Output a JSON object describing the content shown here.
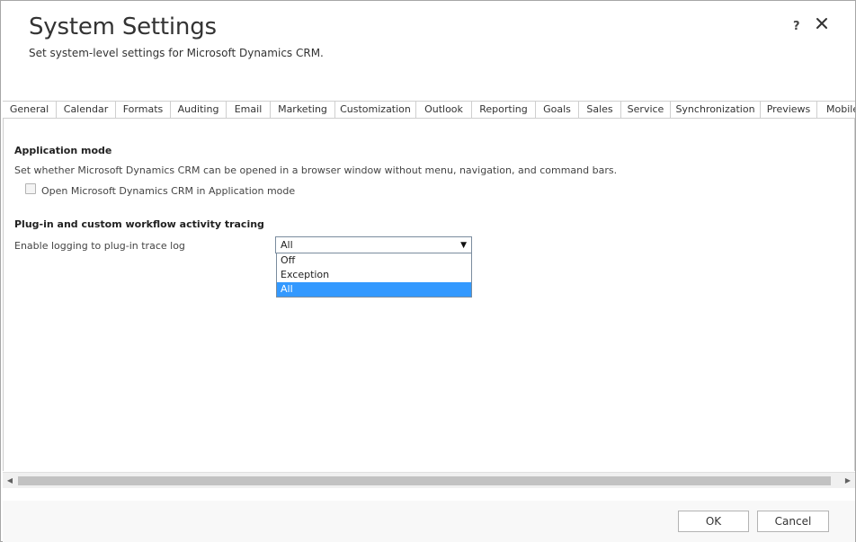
{
  "dialog": {
    "title": "System Settings",
    "subtitle": "Set system-level settings for Microsoft Dynamics CRM.",
    "help_label": "?"
  },
  "tabs": [
    {
      "label": "General"
    },
    {
      "label": "Calendar"
    },
    {
      "label": "Formats"
    },
    {
      "label": "Auditing"
    },
    {
      "label": "Email"
    },
    {
      "label": "Marketing"
    },
    {
      "label": "Customization"
    },
    {
      "label": "Outlook"
    },
    {
      "label": "Reporting"
    },
    {
      "label": "Goals"
    },
    {
      "label": "Sales"
    },
    {
      "label": "Service"
    },
    {
      "label": "Synchronization"
    },
    {
      "label": "Previews"
    },
    {
      "label": "Mobile"
    }
  ],
  "application_mode": {
    "title": "Application mode",
    "description": "Set whether Microsoft Dynamics CRM can be opened in a browser window without menu, navigation, and command bars.",
    "checkbox_label": "Open Microsoft Dynamics CRM in Application mode"
  },
  "tracing": {
    "title": "Plug-in and custom workflow activity tracing",
    "field_label": "Enable logging to plug-in trace log",
    "selected_value": "All",
    "options": [
      "Off",
      "Exception",
      "All"
    ]
  },
  "footer": {
    "ok_label": "OK",
    "cancel_label": "Cancel"
  },
  "colors": {
    "selected_option": "#3399ff",
    "border": "#a6a6a6"
  }
}
